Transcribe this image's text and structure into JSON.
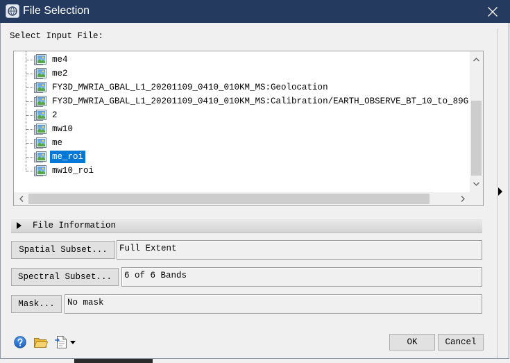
{
  "window": {
    "title": "File Selection",
    "icon": "app-icon",
    "close_icon": "close-icon"
  },
  "input_label": "Select Input File:",
  "tree": {
    "items": [
      {
        "label": "me4",
        "icon": "image-file-icon",
        "selected": false
      },
      {
        "label": "me2",
        "icon": "image-file-icon",
        "selected": false
      },
      {
        "label": "FY3D_MWRIA_GBAL_L1_20201109_0410_010KM_MS:Geolocation",
        "icon": "image-file-icon",
        "selected": false
      },
      {
        "label": "FY3D_MWRIA_GBAL_L1_20201109_0410_010KM_MS:Calibration/EARTH_OBSERVE_BT_10_to_89G",
        "icon": "image-file-icon",
        "selected": false
      },
      {
        "label": "2",
        "icon": "image-file-icon",
        "selected": false
      },
      {
        "label": "mw10",
        "icon": "image-file-icon",
        "selected": false
      },
      {
        "label": "me",
        "icon": "image-file-icon",
        "selected": false
      },
      {
        "label": "me_roi",
        "icon": "image-file-icon",
        "selected": true
      },
      {
        "label": "mw10_roi",
        "icon": "image-file-icon",
        "selected": false
      }
    ],
    "vertical_scrollbar": {
      "scrolled_percent": 100,
      "visible_percent": 70,
      "up_icon": "chevron-up-icon",
      "down_icon": "chevron-down-icon"
    },
    "horizontal_scrollbar": {
      "scrolled_percent": 0,
      "visible_percent": 94,
      "left_icon": "chevron-left-icon",
      "right_icon": "chevron-right-icon"
    }
  },
  "file_information": {
    "label": "File Information",
    "expanded": false,
    "icon": "triangle-right-icon"
  },
  "spatial_subset": {
    "button_label": "Spatial Subset...",
    "value": "Full Extent"
  },
  "spectral_subset": {
    "button_label": "Spectral Subset...",
    "value": "6 of 6 Bands"
  },
  "mask": {
    "button_label": "Mask...",
    "value": "No mask"
  },
  "footer": {
    "icons": [
      "help-icon",
      "open-folder-icon",
      "options-menu-icon"
    ],
    "ok_label": "OK",
    "cancel_label": "Cancel"
  },
  "side_panel": {
    "expand_icon": "triangle-right-icon"
  },
  "colors": {
    "title_bar": "#243a5e",
    "title_text": "#ffffff",
    "selection": "#0078d7",
    "selection_text": "#ffffff",
    "dialog_background": "#f0f0f0"
  }
}
